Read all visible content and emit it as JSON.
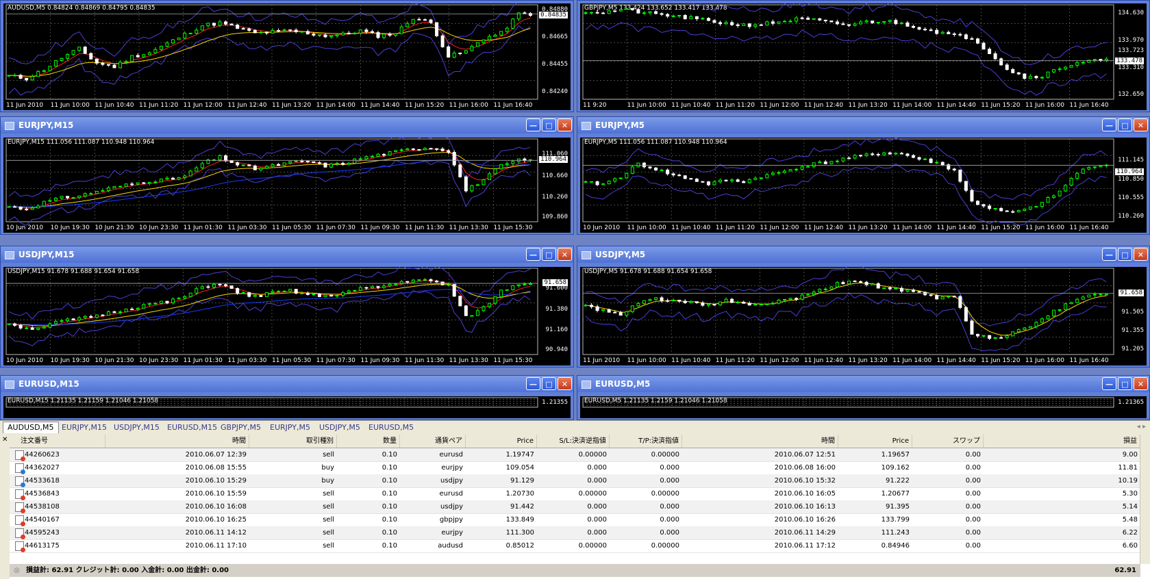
{
  "colors": {
    "bull": "#00ff00",
    "bear": "#ffffff",
    "band": "#4a3fd6",
    "ma_fast": "#ff2020",
    "ma_slow": "#ffd800",
    "ma_long": "#1a3bff"
  },
  "windows": [
    {
      "id": "audusd_m5",
      "title": "",
      "label": "AUDUSD,M5  0.84824 0.84869 0.84795 0.84835",
      "prices": [
        "0.84880",
        "0.84835",
        "0.84665",
        "0.84455",
        "0.84240"
      ],
      "current": "0.84835",
      "times": [
        "11 Jun 2010",
        "11 Jun 10:00",
        "11 Jun 10:40",
        "11 Jun 11:20",
        "11 Jun 12:00",
        "11 Jun 12:40",
        "11 Jun 13:20",
        "11 Jun 14:00",
        "11 Jun 14:40",
        "11 Jun 15:20",
        "11 Jun 16:00",
        "11 Jun 16:40"
      ],
      "chart": {
        "min": 0.842,
        "max": 0.8492,
        "seed": 11,
        "ma": [
          "ma_fast",
          "ma_slow"
        ],
        "series": [
          0.8437,
          0.8435,
          0.8442,
          0.8451,
          0.8458,
          0.8447,
          0.8444,
          0.8452,
          0.8455,
          0.8462,
          0.8469,
          0.8476,
          0.8478,
          0.8474,
          0.847,
          0.8471,
          0.8472,
          0.847,
          0.8468,
          0.8469,
          0.8472,
          0.8468,
          0.847,
          0.8482,
          0.8478,
          0.8452,
          0.8456,
          0.8466,
          0.847,
          0.8485
        ]
      }
    },
    {
      "id": "gbpjpy_m5",
      "title": "",
      "label": "GBPJPY,M5  133.424 133.652 133.417 133.478",
      "prices": [
        "134.630",
        "133.970",
        "133.723",
        "133.478",
        "133.310",
        "132.650"
      ],
      "current": "133.478",
      "times": [
        "11 9:20",
        "11 Jun 10:00",
        "11 Jun 10:40",
        "11 Jun 11:20",
        "11 Jun 12:00",
        "11 Jun 12:40",
        "11 Jun 13:20",
        "11 Jun 14:00",
        "11 Jun 14:40",
        "11 Jun 15:20",
        "11 Jun 16:00",
        "11 Jun 16:40"
      ],
      "chart": {
        "min": 132.6,
        "max": 134.85,
        "seed": 21,
        "ma": [],
        "series": [
          134.7,
          134.66,
          134.74,
          134.68,
          134.62,
          134.58,
          134.52,
          134.46,
          134.4,
          134.36,
          134.38,
          134.44,
          134.5,
          134.48,
          134.4,
          134.36,
          134.44,
          134.46,
          134.4,
          134.3,
          134.2,
          134.1,
          134.06,
          133.7,
          133.3,
          133.1,
          133.14,
          133.32,
          133.46,
          133.5
        ]
      }
    },
    {
      "id": "eurjpy_m15",
      "title": "EURJPY,M15",
      "label": "EURJPY,M15  111.056 111.087 110.948 110.964",
      "prices": [
        "111.060",
        "110.964",
        "110.660",
        "110.260",
        "109.860"
      ],
      "current": "110.964",
      "times": [
        "10 Jun 2010",
        "10 Jun 19:30",
        "10 Jun 21:30",
        "10 Jun 23:30",
        "11 Jun 01:30",
        "11 Jun 03:30",
        "11 Jun 05:30",
        "11 Jun 07:30",
        "11 Jun 09:30",
        "11 Jun 11:30",
        "11 Jun 13:30",
        "11 Jun 15:30"
      ],
      "chart": {
        "min": 109.84,
        "max": 111.36,
        "seed": 31,
        "ma": [
          "ma_fast",
          "ma_slow",
          "ma_long"
        ],
        "series": [
          110.1,
          110.05,
          110.18,
          110.26,
          110.3,
          110.38,
          110.46,
          110.52,
          110.58,
          110.6,
          110.66,
          110.9,
          111.02,
          110.88,
          110.8,
          110.86,
          110.92,
          110.94,
          110.86,
          110.9,
          111.0,
          111.06,
          111.12,
          111.18,
          111.2,
          111.14,
          110.4,
          110.6,
          110.86,
          110.96
        ]
      }
    },
    {
      "id": "eurjpy_m5",
      "title": "EURJPY,M5",
      "label": "EURJPY,M5  111.056 111.087 110.948 110.964",
      "prices": [
        "111.145",
        "110.964",
        "110.850",
        "110.555",
        "110.260"
      ],
      "current": "110.964",
      "times": [
        "10 Jun 2010",
        "11 Jun 10:00",
        "11 Jun 10:40",
        "11 Jun 11:20",
        "11 Jun 12:00",
        "11 Jun 12:40",
        "11 Jun 13:20",
        "11 Jun 14:00",
        "11 Jun 14:40",
        "11 Jun 15:20",
        "11 Jun 16:00",
        "11 Jun 16:40"
      ],
      "chart": {
        "min": 110.2,
        "max": 111.5,
        "seed": 41,
        "ma": [],
        "series": [
          110.8,
          110.78,
          110.9,
          111.1,
          111.02,
          110.92,
          110.86,
          110.78,
          110.84,
          110.82,
          110.9,
          110.96,
          111.04,
          111.1,
          111.14,
          111.2,
          111.24,
          111.28,
          111.26,
          111.18,
          111.12,
          111.0,
          110.5,
          110.4,
          110.32,
          110.36,
          110.48,
          110.66,
          110.96,
          111.08
        ]
      }
    },
    {
      "id": "usdjpy_m15",
      "title": "USDJPY,M15",
      "label": "USDJPY,M15  91.678 91.688 91.654 91.658",
      "prices": [
        "91.658",
        "91.600",
        "91.380",
        "91.160",
        "90.940"
      ],
      "current": "91.658",
      "times": [
        "10 Jun 2010",
        "10 Jun 19:30",
        "10 Jun 21:30",
        "10 Jun 23:30",
        "11 Jun 01:30",
        "11 Jun 03:30",
        "11 Jun 05:30",
        "11 Jun 07:30",
        "11 Jun 09:30",
        "11 Jun 11:30",
        "11 Jun 13:30",
        "11 Jun 15:30"
      ],
      "chart": {
        "min": 90.92,
        "max": 91.82,
        "seed": 51,
        "ma": [
          "ma_fast",
          "ma_slow",
          "ma_long"
        ],
        "series": [
          91.24,
          91.18,
          91.2,
          91.26,
          91.28,
          91.32,
          91.36,
          91.4,
          91.44,
          91.46,
          91.52,
          91.62,
          91.66,
          91.56,
          91.52,
          91.56,
          91.58,
          91.54,
          91.52,
          91.56,
          91.6,
          91.62,
          91.66,
          91.7,
          91.68,
          91.64,
          91.3,
          91.4,
          91.58,
          91.66
        ]
      }
    },
    {
      "id": "usdjpy_m5",
      "title": "USDJPY,M5",
      "label": "USDJPY,M5  91.678 91.688 91.654 91.658",
      "prices": [
        "91.658",
        "91.505",
        "91.355",
        "91.205"
      ],
      "current": "91.658",
      "times": [
        "11 Jun 2010",
        "11 Jun 10:00",
        "11 Jun 10:40",
        "11 Jun 11:20",
        "11 Jun 12:00",
        "11 Jun 12:40",
        "11 Jun 13:20",
        "11 Jun 14:00",
        "11 Jun 14:40",
        "11 Jun 15:20",
        "11 Jun 16:00",
        "11 Jun 16:40"
      ],
      "chart": {
        "min": 91.18,
        "max": 91.86,
        "seed": 61,
        "ma": [
          "ma_slow"
        ],
        "series": [
          91.56,
          91.52,
          91.48,
          91.58,
          91.62,
          91.6,
          91.58,
          91.56,
          91.6,
          91.58,
          91.56,
          91.6,
          91.62,
          91.66,
          91.72,
          91.76,
          91.74,
          91.7,
          91.68,
          91.66,
          91.62,
          91.64,
          91.34,
          91.3,
          91.32,
          91.38,
          91.46,
          91.54,
          91.62,
          91.66
        ]
      }
    },
    {
      "id": "eurusd_m15",
      "title": "EURUSD,M15",
      "label": "EURUSD,M15  1.21135 1.21159 1.21046 1.21058",
      "prices": [
        "1.21355"
      ],
      "current": "",
      "times": [],
      "chart": {
        "min": 1.209,
        "max": 1.215,
        "seed": 71,
        "ma": [],
        "series": []
      }
    },
    {
      "id": "eurusd_m5",
      "title": "EURUSD,M5",
      "label": "EURUSD,M5  1.21135 1.2159 1.21046 1.21058",
      "prices": [
        "1.21365"
      ],
      "current": "",
      "times": [],
      "chart": {
        "min": 1.209,
        "max": 1.215,
        "seed": 81,
        "ma": [],
        "series": []
      }
    }
  ],
  "tabs": [
    "AUDUSD,M5",
    "EURJPY,M15",
    "USDJPY,M15",
    "EURUSD,M15",
    "GBPJPY,M5",
    "EURJPY,M5",
    "USDJPY,M5",
    "EURUSD,M5"
  ],
  "table": {
    "headers": [
      "注文番号",
      "時間",
      "取引種別",
      "数量",
      "通貨ペア",
      "Price",
      "S/L:決済逆指値",
      "T/P:決済指値",
      "時間",
      "Price",
      "スワップ",
      "損益"
    ],
    "rows": [
      {
        "type": "sell",
        "cells": [
          "44260623",
          "2010.06.07 12:39",
          "sell",
          "0.10",
          "eurusd",
          "1.19747",
          "0.00000",
          "0.00000",
          "2010.06.07 12:51",
          "1.19657",
          "0.00",
          "9.00"
        ]
      },
      {
        "type": "buy",
        "cells": [
          "44362027",
          "2010.06.08 15:55",
          "buy",
          "0.10",
          "eurjpy",
          "109.054",
          "0.000",
          "0.000",
          "2010.06.08 16:00",
          "109.162",
          "0.00",
          "11.81"
        ]
      },
      {
        "type": "buy",
        "cells": [
          "44533618",
          "2010.06.10 15:29",
          "buy",
          "0.10",
          "usdjpy",
          "91.129",
          "0.000",
          "0.000",
          "2010.06.10 15:32",
          "91.222",
          "0.00",
          "10.19"
        ]
      },
      {
        "type": "sell",
        "cells": [
          "44536843",
          "2010.06.10 15:59",
          "sell",
          "0.10",
          "eurusd",
          "1.20730",
          "0.00000",
          "0.00000",
          "2010.06.10 16:05",
          "1.20677",
          "0.00",
          "5.30"
        ]
      },
      {
        "type": "sell",
        "cells": [
          "44538108",
          "2010.06.10 16:08",
          "sell",
          "0.10",
          "usdjpy",
          "91.442",
          "0.000",
          "0.000",
          "2010.06.10 16:13",
          "91.395",
          "0.00",
          "5.14"
        ]
      },
      {
        "type": "sell",
        "cells": [
          "44540167",
          "2010.06.10 16:25",
          "sell",
          "0.10",
          "gbpjpy",
          "133.849",
          "0.000",
          "0.000",
          "2010.06.10 16:26",
          "133.799",
          "0.00",
          "5.48"
        ]
      },
      {
        "type": "sell",
        "cells": [
          "44595243",
          "2010.06.11 14:12",
          "sell",
          "0.10",
          "eurjpy",
          "111.300",
          "0.000",
          "0.000",
          "2010.06.11 14:29",
          "111.243",
          "0.00",
          "6.22"
        ]
      },
      {
        "type": "sell",
        "cells": [
          "44613175",
          "2010.06.11 17:10",
          "sell",
          "0.10",
          "audusd",
          "0.85012",
          "0.00000",
          "0.00000",
          "2010.06.11 17:12",
          "0.84946",
          "0.00",
          "6.60"
        ]
      }
    ],
    "summary": "損益計: 62.91  クレジット計: 0.00  入金計: 0.00  出金計: 0.00",
    "total": "62.91"
  }
}
